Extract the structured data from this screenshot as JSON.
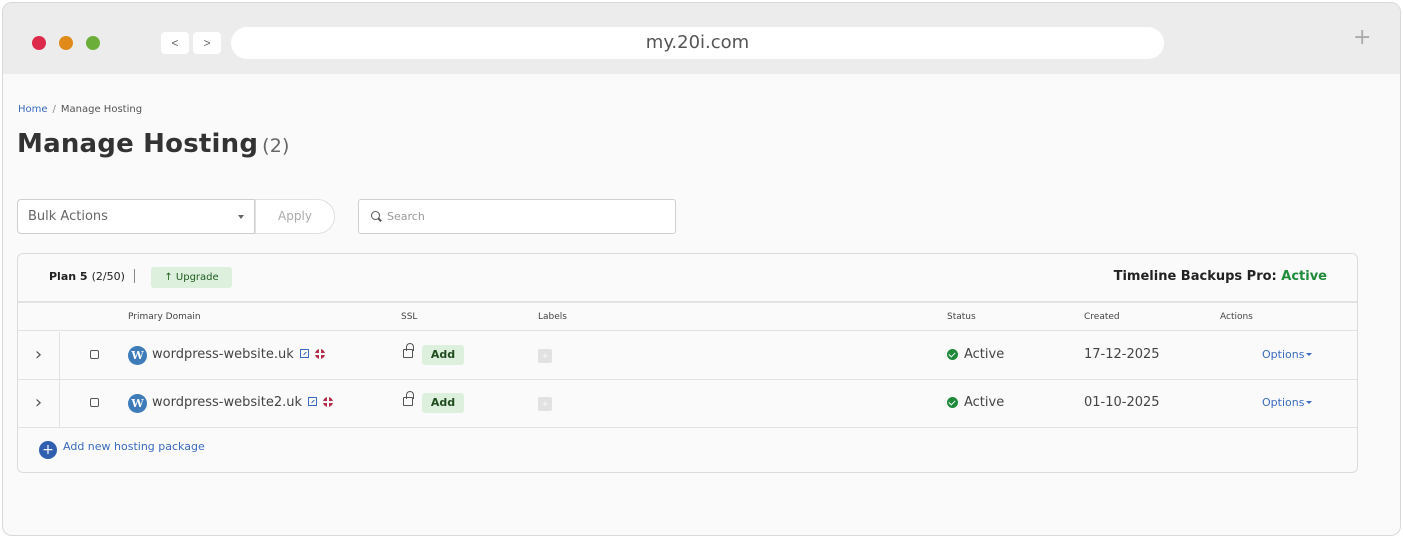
{
  "browser": {
    "url": "my.20i.com",
    "back_label": "<",
    "forward_label": ">",
    "new_tab_label": "+"
  },
  "breadcrumb": {
    "home": "Home",
    "separator": "/",
    "current": "Manage Hosting"
  },
  "page": {
    "title": "Manage Hosting",
    "count": "(2)"
  },
  "toolbar": {
    "bulk_actions": "Bulk Actions",
    "apply": "Apply",
    "search_placeholder": "Search"
  },
  "plan": {
    "name": "Plan 5",
    "usage": "(2/50)",
    "upgrade": "Upgrade",
    "backups_label": "Timeline Backups Pro:",
    "backups_status": "Active"
  },
  "table": {
    "headers": {
      "domain": "Primary Domain",
      "ssl": "SSL",
      "labels": "Labels",
      "status": "Status",
      "created": "Created",
      "actions": "Actions"
    },
    "rows": [
      {
        "domain": "wordpress-website.uk",
        "ssl": "Add",
        "status": "Active",
        "created": "17-12-2025",
        "actions": "Options"
      },
      {
        "domain": "wordpress-website2.uk",
        "ssl": "Add",
        "status": "Active",
        "created": "01-10-2025",
        "actions": "Options"
      }
    ],
    "add_new": "Add new hosting package"
  },
  "colors": {
    "accent": "#3a6bbf",
    "active_green": "#1e8a3a",
    "upgrade_bg": "#ddf0dd"
  }
}
